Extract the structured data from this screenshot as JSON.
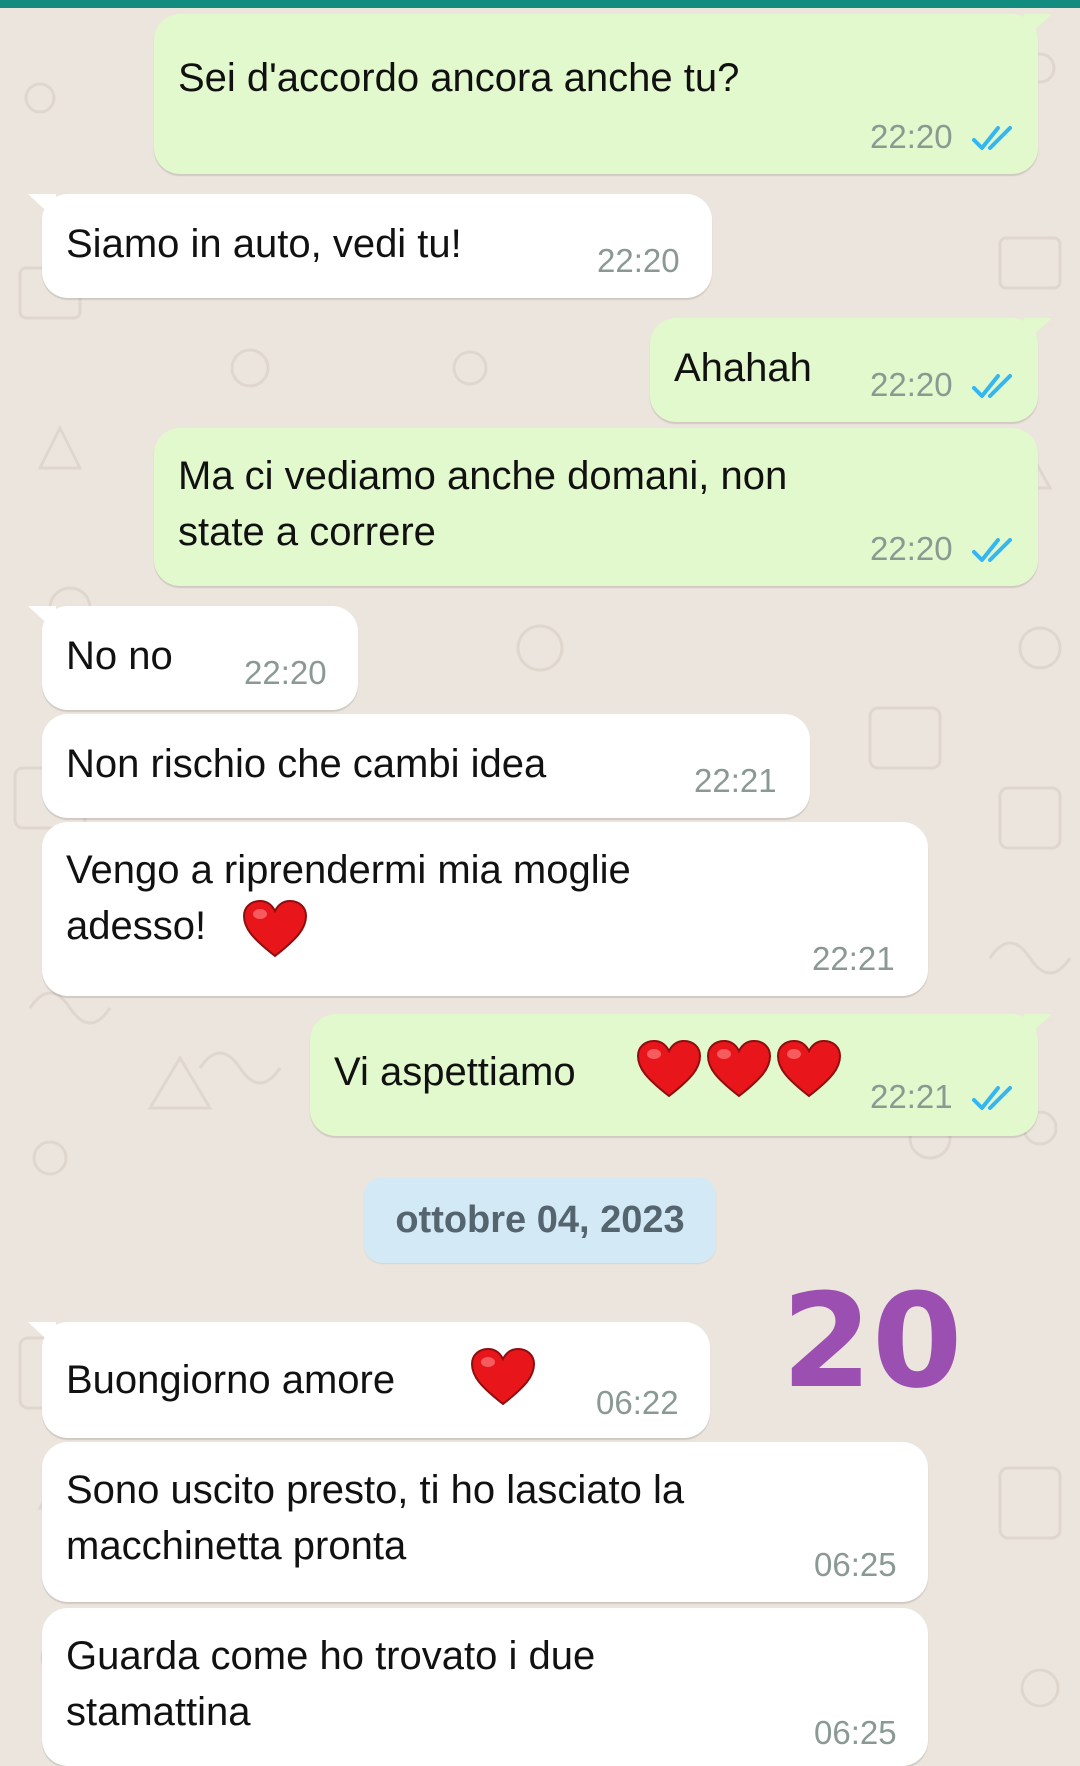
{
  "colors": {
    "outgoing_bubble": "#E2F8CD",
    "incoming_bubble": "#FFFFFF",
    "background": "#ECE5DD",
    "read_ticks": "#34B7F1",
    "date_chip": "#D4E9F6",
    "sticker": "#9B4FB0",
    "heart": "#E8161B"
  },
  "messages": [
    {
      "direction": "out",
      "text": "Sei d'accordo ancora anche tu?",
      "time": "22:20",
      "status": "read"
    },
    {
      "direction": "in",
      "text": "Siamo in auto, vedi tu!",
      "time": "22:20"
    },
    {
      "direction": "out",
      "text": "Ahahah",
      "time": "22:20",
      "status": "read"
    },
    {
      "direction": "out",
      "text": "Ma ci vediamo anche domani, non\nstate a correre",
      "time": "22:20",
      "status": "read"
    },
    {
      "direction": "in",
      "text": "No no",
      "time": "22:20"
    },
    {
      "direction": "in",
      "text": "Non rischio che cambi idea",
      "time": "22:21"
    },
    {
      "direction": "in",
      "text": "Vengo a riprendermi mia moglie\nadesso!",
      "emoji": "heart",
      "time": "22:21"
    },
    {
      "direction": "out",
      "text": "Vi aspettiamo",
      "emoji": "heart x3",
      "time": "22:21",
      "status": "read"
    },
    {
      "direction": "in",
      "text": "Buongiorno amore",
      "emoji": "heart",
      "time": "06:22"
    },
    {
      "direction": "in",
      "text": "Sono uscito presto, ti ho lasciato la\nmacchinetta pronta",
      "time": "06:25"
    },
    {
      "direction": "in",
      "text": "Guarda come ho trovato i due\nstamattina",
      "time": "06:25"
    }
  ],
  "date_separator": "ottobre 04, 2023",
  "sticker": {
    "text": "20",
    "icon": "handwritten-number-sticker"
  },
  "icons": {
    "read_receipt": "double-check-icon",
    "emoji": "red-heart-icon"
  }
}
